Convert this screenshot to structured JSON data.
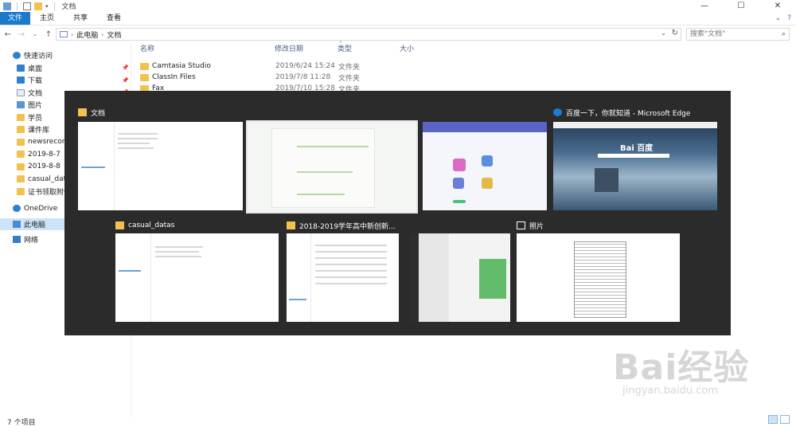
{
  "window": {
    "title": "文档",
    "controls": {
      "minimize": "—",
      "maximize": "☐",
      "close": "✕"
    }
  },
  "ribbon": {
    "tabs": [
      "文件",
      "主页",
      "共享",
      "查看"
    ],
    "right_chevron": "⌄",
    "help": "?"
  },
  "address": {
    "crumbs": [
      "此电脑",
      "文档"
    ],
    "search_placeholder": "搜索\"文档\""
  },
  "sidebar": {
    "quick_access": "快速访问",
    "items": [
      {
        "label": "桌面",
        "icon": "desktop-icon",
        "pinned": true
      },
      {
        "label": "下载",
        "icon": "download-icon",
        "pinned": true
      },
      {
        "label": "文档",
        "icon": "documents-icon",
        "pinned": true
      },
      {
        "label": "图片",
        "icon": "pictures-icon",
        "pinned": true
      },
      {
        "label": "学员",
        "icon": "folder-icon",
        "pinned": false
      },
      {
        "label": "课件库",
        "icon": "folder-icon",
        "pinned": false
      },
      {
        "label": "newsrecord",
        "icon": "folder-icon",
        "pinned": false
      },
      {
        "label": "2019-8-7",
        "icon": "folder-icon",
        "pinned": false
      },
      {
        "label": "2019-8-8",
        "icon": "folder-icon",
        "pinned": false
      },
      {
        "label": "casual_datas",
        "icon": "folder-icon",
        "pinned": false
      },
      {
        "label": "证书领取附件",
        "icon": "folder-icon",
        "pinned": false
      }
    ],
    "onedrive": "OneDrive",
    "this_pc": "此电脑",
    "network": "网络"
  },
  "columns": {
    "name": "名称",
    "date": "修改日期",
    "type": "类型",
    "size": "大小"
  },
  "files": [
    {
      "name": "Camtasia Studio",
      "date": "2019/6/24 15:24",
      "type": "文件夹"
    },
    {
      "name": "ClassIn Files",
      "date": "2019/7/8 11:28",
      "type": "文件夹"
    },
    {
      "name": "Fax",
      "date": "2019/7/10 15:28",
      "type": "文件夹"
    }
  ],
  "status": {
    "item_count": "7 个项目"
  },
  "task_switcher": {
    "windows": [
      {
        "title": "文档",
        "icon": "folder-explorer-icon"
      },
      {
        "title": "",
        "icon": ""
      },
      {
        "title": "",
        "icon": ""
      },
      {
        "title": "百度一下，你就知道 - Microsoft Edge",
        "icon": "edge-icon"
      },
      {
        "title": "casual_datas",
        "icon": "folder-explorer-icon"
      },
      {
        "title": "2018-2019学年高中新创新...",
        "icon": "folder-explorer-icon"
      },
      {
        "title": "",
        "icon": ""
      },
      {
        "title": "照片",
        "icon": "photos-icon"
      }
    ]
  },
  "watermark": {
    "brand": "Bai经验",
    "domain": "jingyan.baidu.com"
  },
  "colors": {
    "accent": "#1979ca",
    "switcher_bg": "#2b2b2b",
    "folder": "#f2c24f",
    "selected": "#cce4f7"
  }
}
